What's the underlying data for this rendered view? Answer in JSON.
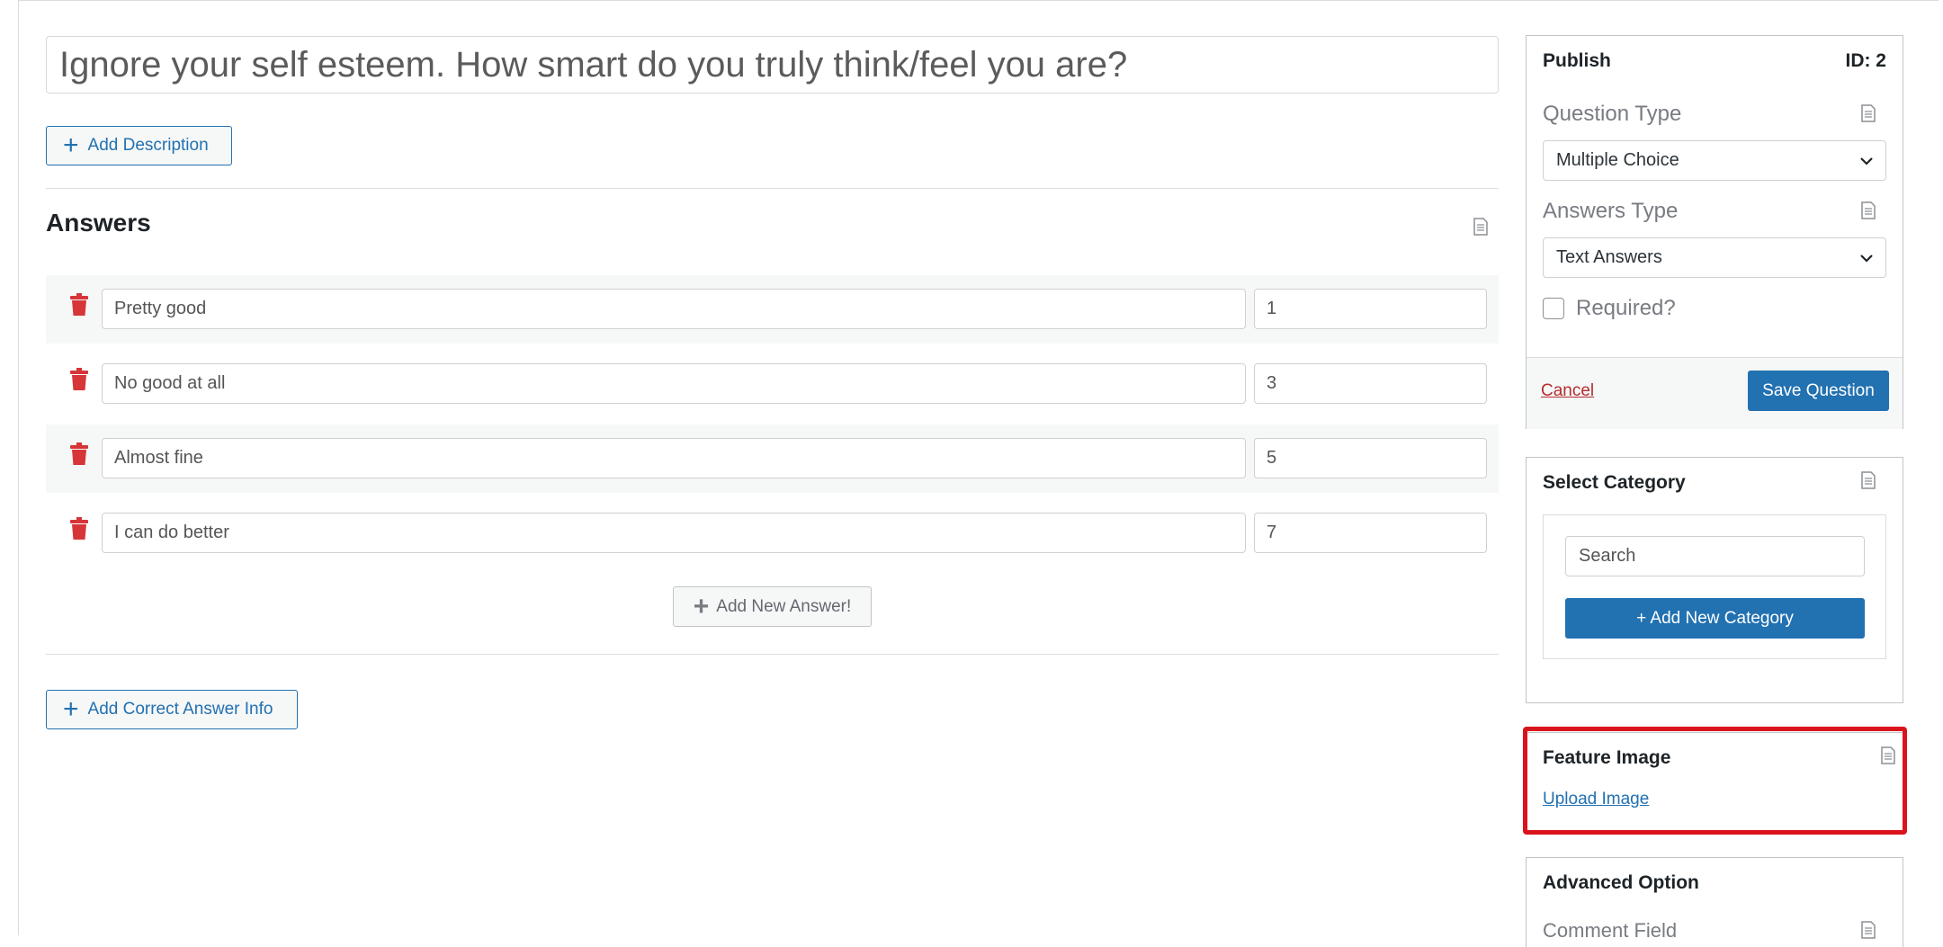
{
  "question": {
    "title": "Ignore your self esteem. How smart do you truly think/feel you are?",
    "add_description_label": "Add Description"
  },
  "answers": {
    "heading": "Answers",
    "items": [
      {
        "text": "Pretty good",
        "value": "1"
      },
      {
        "text": "No good at all",
        "value": "3"
      },
      {
        "text": "Almost fine",
        "value": "5"
      },
      {
        "text": "I can do better",
        "value": "7"
      }
    ],
    "add_new_label": "Add New Answer!",
    "add_correct_info_label": "Add Correct Answer Info"
  },
  "publish": {
    "title": "Publish",
    "id_label": "ID: 2",
    "question_type_label": "Question Type",
    "question_type_value": "Multiple Choice",
    "answers_type_label": "Answers Type",
    "answers_type_value": "Text Answers",
    "required_label": "Required?",
    "cancel_label": "Cancel",
    "save_label": "Save Question"
  },
  "category": {
    "title": "Select Category",
    "search_placeholder": "Search",
    "add_label": "+ Add New Category"
  },
  "feature_image": {
    "title": "Feature Image",
    "upload_label": "Upload Image"
  },
  "advanced": {
    "title": "Advanced Option",
    "comment_field_label": "Comment Field"
  },
  "colors": {
    "primary": "#2271b1",
    "danger": "#d63638",
    "highlight": "#d9141c"
  },
  "icons": {
    "doc": "document-icon",
    "trash": "trash-icon",
    "plus": "plus-icon",
    "chevron": "chevron-down-icon"
  }
}
